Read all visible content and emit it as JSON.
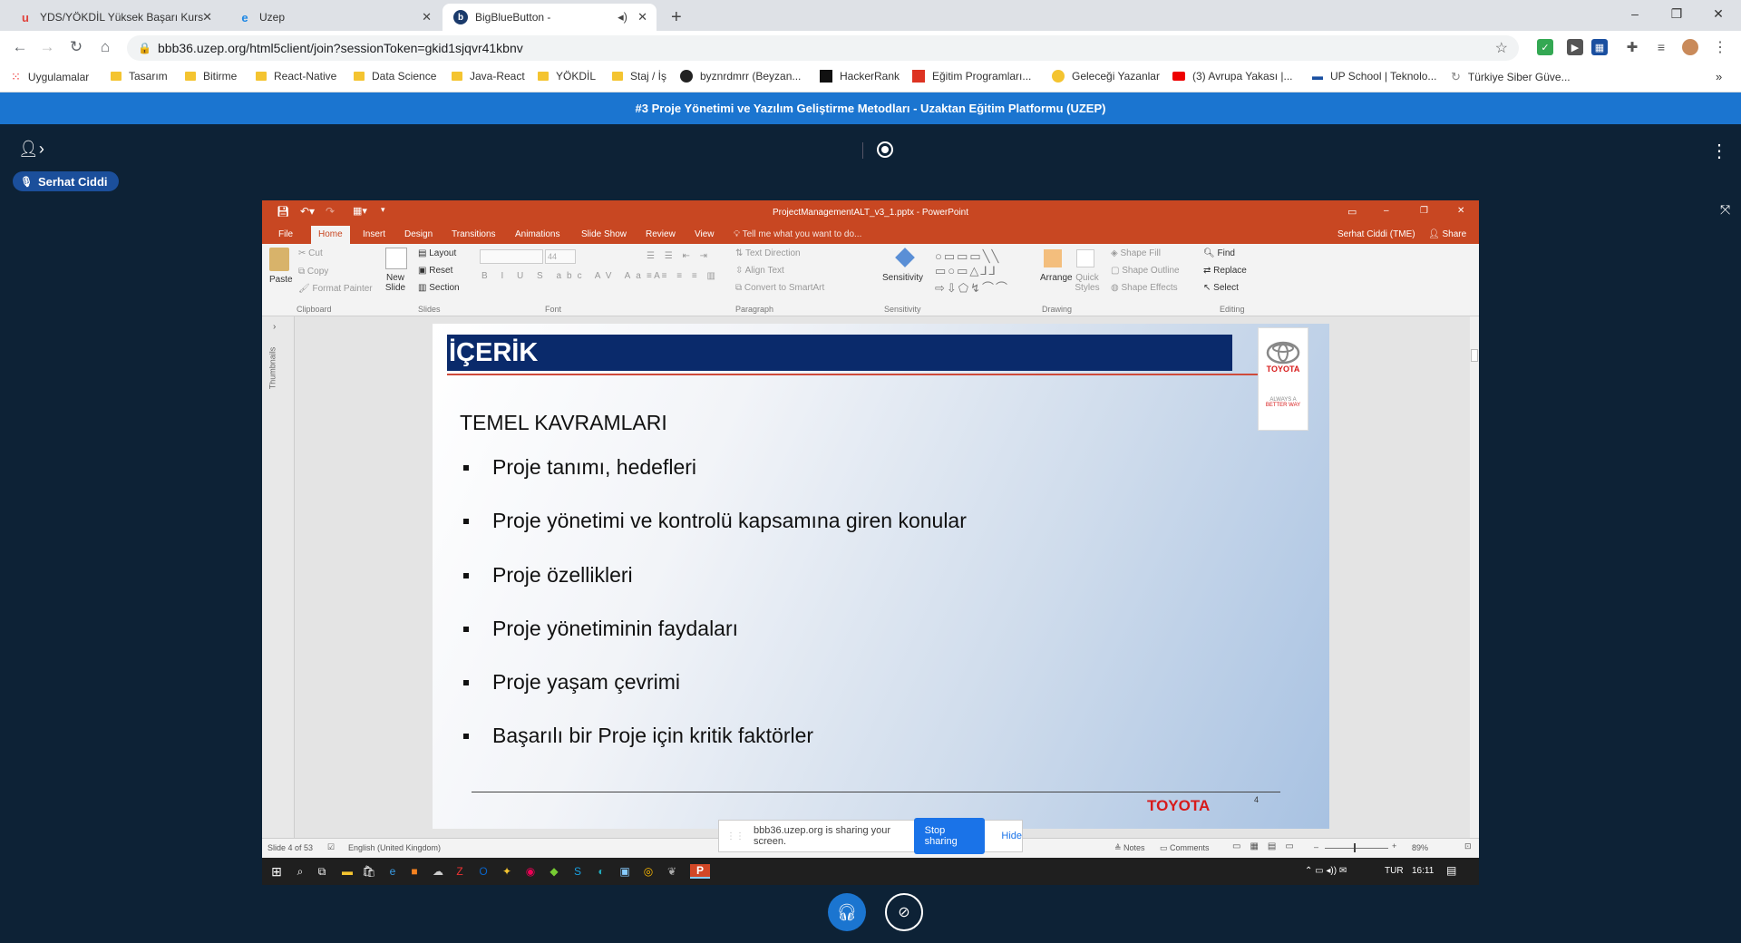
{
  "browser": {
    "tabs": [
      {
        "title": "YDS/YÖKDİL Yüksek Başarı Kursu",
        "icon": "udemy-icon"
      },
      {
        "title": "Uzep",
        "icon": "edge-icon"
      },
      {
        "title": "BigBlueButton -",
        "icon": "bbb-icon"
      }
    ],
    "url": "bbb36.uzep.org/html5client/join?sessionToken=gkid1sjqvr41kbnv",
    "bookmarks": [
      "Uygulamalar",
      "Tasarım",
      "Bitirme",
      "React-Native",
      "Data Science",
      "Java-React",
      "YÖKDİL",
      "Staj / İş",
      "byznrdmrr (Beyzan...",
      "HackerRank",
      "Eğitim Programları...",
      "Geleceği Yazanlar",
      "(3) Avrupa Yakası |...",
      "UP School | Teknolo...",
      "Türkiye Siber Güve..."
    ]
  },
  "bbb": {
    "title": "#3 Proje Yönetimi ve Yazılım Geliştirme Metodları - Uzaktan Eğitim Platformu (UZEP)",
    "presenter": "Serhat Ciddi"
  },
  "ppt": {
    "window_title": "ProjectManagementALT_v3_1.pptx - PowerPoint",
    "user": "Serhat Ciddi (TME)",
    "share": "Share",
    "tabs": [
      "File",
      "Home",
      "Insert",
      "Design",
      "Transitions",
      "Animations",
      "Slide Show",
      "Review",
      "View"
    ],
    "tell_me": "Tell me what you want to do...",
    "ribbon": {
      "paste": "Paste",
      "cut": "Cut",
      "copy": "Copy",
      "format_painter": "Format Painter",
      "new_slide": "New Slide",
      "layout": "Layout",
      "reset": "Reset",
      "section": "Section",
      "font_size": "44",
      "text_direction": "Text Direction",
      "align_text": "Align Text",
      "convert": "Convert to SmartArt",
      "sensitivity": "Sensitivity",
      "arrange": "Arrange",
      "quick_styles": "Quick Styles",
      "shape_fill": "Shape Fill",
      "shape_outline": "Shape Outline",
      "shape_effects": "Shape Effects",
      "find": "Find",
      "replace": "Replace",
      "select": "Select",
      "groups": [
        "Clipboard",
        "Slides",
        "Font",
        "Paragraph",
        "Sensitivity",
        "Drawing",
        "Editing"
      ]
    },
    "thumbnails_label": "Thumbnails",
    "slide": {
      "header": "İÇERİK",
      "subtitle": "TEMEL KAVRAMLARI",
      "bullets": [
        "Proje tanımı, hedefleri",
        "Proje yönetimi ve kontrolü kapsamına giren konular",
        "Proje özellikleri",
        "Proje yönetiminin faydaları",
        "Proje yaşam çevrimi",
        "Başarılı bir Proje için kritik faktörler"
      ],
      "logo_text": "TOYOTA",
      "logo_tag1": "ALWAYS A",
      "logo_tag2": "BETTER WAY",
      "footer_brand": "TOYOTA",
      "page_number": "4"
    },
    "status": {
      "slide_info": "Slide 4 of 53",
      "language": "English (United Kingdom)",
      "notes": "Notes",
      "comments": "Comments",
      "zoom": "89%"
    },
    "taskbar": {
      "lang": "TUR",
      "time": "16:11"
    }
  },
  "sharing": {
    "message": "bbb36.uzep.org is sharing your screen.",
    "stop": "Stop sharing",
    "hide": "Hide"
  },
  "colors": {
    "bbb_blue": "#1b75d0",
    "ppt_orange": "#c84722",
    "bg": "#0d2236"
  }
}
